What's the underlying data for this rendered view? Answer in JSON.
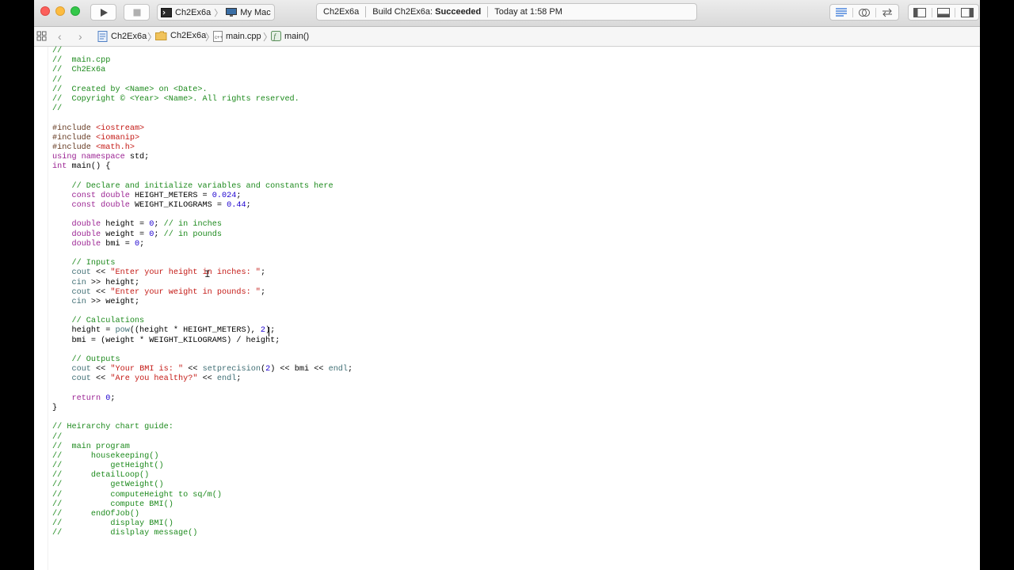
{
  "toolbar": {
    "scheme_target": "Ch2Ex6a",
    "scheme_device": "My Mac",
    "status_project": "Ch2Ex6a",
    "status_build_prefix": "Build Ch2Ex6a:",
    "status_build_result": "Succeeded",
    "status_time": "Today at 1:58 PM"
  },
  "jumpbar": {
    "items": [
      "Ch2Ex6a",
      "Ch2Ex6a",
      "main.cpp",
      "main()"
    ]
  },
  "editor": {
    "lines": [
      [
        {
          "t": "//",
          "c": "c"
        }
      ],
      [
        {
          "t": "//  main.cpp",
          "c": "c"
        }
      ],
      [
        {
          "t": "//  Ch2Ex6a",
          "c": "c"
        }
      ],
      [
        {
          "t": "//",
          "c": "c"
        }
      ],
      [
        {
          "t": "//  Created by <Name> on <Date>.",
          "c": "c"
        }
      ],
      [
        {
          "t": "//  Copyright © <Year> <Name>. All rights reserved.",
          "c": "c"
        }
      ],
      [
        {
          "t": "//",
          "c": "c"
        }
      ],
      [],
      [
        {
          "t": "#include ",
          "c": "p"
        },
        {
          "t": "<iostream>",
          "c": "s"
        }
      ],
      [
        {
          "t": "#include ",
          "c": "p"
        },
        {
          "t": "<iomanip>",
          "c": "s"
        }
      ],
      [
        {
          "t": "#include ",
          "c": "p"
        },
        {
          "t": "<math.h>",
          "c": "s"
        }
      ],
      [
        {
          "t": "using namespace ",
          "c": "k"
        },
        {
          "t": "std;",
          "c": ""
        }
      ],
      [
        {
          "t": "int ",
          "c": "k"
        },
        {
          "t": "main() {",
          "c": ""
        }
      ],
      [],
      [
        {
          "t": "    // Declare and initialize variables and constants here",
          "c": "c"
        }
      ],
      [
        {
          "t": "    ",
          "c": ""
        },
        {
          "t": "const double ",
          "c": "k"
        },
        {
          "t": "HEIGHT_METERS = ",
          "c": ""
        },
        {
          "t": "0.024",
          "c": "n"
        },
        {
          "t": ";",
          "c": ""
        }
      ],
      [
        {
          "t": "    ",
          "c": ""
        },
        {
          "t": "const double ",
          "c": "k"
        },
        {
          "t": "WEIGHT_KILOGRAMS = ",
          "c": ""
        },
        {
          "t": "0.44",
          "c": "n"
        },
        {
          "t": ";",
          "c": ""
        }
      ],
      [],
      [
        {
          "t": "    ",
          "c": ""
        },
        {
          "t": "double ",
          "c": "k"
        },
        {
          "t": "height = ",
          "c": ""
        },
        {
          "t": "0",
          "c": "n"
        },
        {
          "t": "; ",
          "c": ""
        },
        {
          "t": "// in inches",
          "c": "c"
        }
      ],
      [
        {
          "t": "    ",
          "c": ""
        },
        {
          "t": "double ",
          "c": "k"
        },
        {
          "t": "weight = ",
          "c": ""
        },
        {
          "t": "0",
          "c": "n"
        },
        {
          "t": "; ",
          "c": ""
        },
        {
          "t": "// in pounds",
          "c": "c"
        }
      ],
      [
        {
          "t": "    ",
          "c": ""
        },
        {
          "t": "double ",
          "c": "k"
        },
        {
          "t": "bmi = ",
          "c": ""
        },
        {
          "t": "0",
          "c": "n"
        },
        {
          "t": ";",
          "c": ""
        }
      ],
      [],
      [
        {
          "t": "    // Inputs",
          "c": "c"
        }
      ],
      [
        {
          "t": "    ",
          "c": ""
        },
        {
          "t": "cout",
          "c": "d"
        },
        {
          "t": " << ",
          "c": ""
        },
        {
          "t": "\"Enter your height in inches: \"",
          "c": "s"
        },
        {
          "t": ";",
          "c": ""
        }
      ],
      [
        {
          "t": "    ",
          "c": ""
        },
        {
          "t": "cin",
          "c": "d"
        },
        {
          "t": " >> height;",
          "c": ""
        }
      ],
      [
        {
          "t": "    ",
          "c": ""
        },
        {
          "t": "cout",
          "c": "d"
        },
        {
          "t": " << ",
          "c": ""
        },
        {
          "t": "\"Enter your weight in pounds: \"",
          "c": "s"
        },
        {
          "t": ";",
          "c": ""
        }
      ],
      [
        {
          "t": "    ",
          "c": ""
        },
        {
          "t": "cin",
          "c": "d"
        },
        {
          "t": " >> weight;",
          "c": ""
        }
      ],
      [],
      [
        {
          "t": "    // Calculations",
          "c": "c"
        }
      ],
      [
        {
          "t": "    height = ",
          "c": ""
        },
        {
          "t": "pow",
          "c": "d"
        },
        {
          "t": "((height * HEIGHT_METERS), ",
          "c": ""
        },
        {
          "t": "2",
          "c": "n"
        },
        {
          "t": ");",
          "c": ""
        }
      ],
      [
        {
          "t": "    bmi = (weight * WEIGHT_KILOGRAMS) / height;",
          "c": ""
        }
      ],
      [],
      [
        {
          "t": "    // Outputs",
          "c": "c"
        }
      ],
      [
        {
          "t": "    ",
          "c": ""
        },
        {
          "t": "cout",
          "c": "d"
        },
        {
          "t": " << ",
          "c": ""
        },
        {
          "t": "\"Your BMI is: \"",
          "c": "s"
        },
        {
          "t": " << ",
          "c": ""
        },
        {
          "t": "setprecision",
          "c": "d"
        },
        {
          "t": "(",
          "c": ""
        },
        {
          "t": "2",
          "c": "n"
        },
        {
          "t": ") << bmi << ",
          "c": ""
        },
        {
          "t": "endl",
          "c": "d"
        },
        {
          "t": ";",
          "c": ""
        }
      ],
      [
        {
          "t": "    ",
          "c": ""
        },
        {
          "t": "cout",
          "c": "d"
        },
        {
          "t": " << ",
          "c": ""
        },
        {
          "t": "\"Are you healthy?\"",
          "c": "s"
        },
        {
          "t": " << ",
          "c": ""
        },
        {
          "t": "endl",
          "c": "d"
        },
        {
          "t": ";",
          "c": ""
        }
      ],
      [],
      [
        {
          "t": "    ",
          "c": ""
        },
        {
          "t": "return ",
          "c": "k"
        },
        {
          "t": "0",
          "c": "n"
        },
        {
          "t": ";",
          "c": ""
        }
      ],
      [
        {
          "t": "}",
          "c": ""
        }
      ],
      [],
      [
        {
          "t": "// Heirarchy chart guide:",
          "c": "c"
        }
      ],
      [
        {
          "t": "//",
          "c": "c"
        }
      ],
      [
        {
          "t": "//  main program",
          "c": "c"
        }
      ],
      [
        {
          "t": "//      housekeeping()",
          "c": "c"
        }
      ],
      [
        {
          "t": "//          getHeight()",
          "c": "c"
        }
      ],
      [
        {
          "t": "//      detailLoop()",
          "c": "c"
        }
      ],
      [
        {
          "t": "//          getWeight()",
          "c": "c"
        }
      ],
      [
        {
          "t": "//          computeHeight to sq/m()",
          "c": "c"
        }
      ],
      [
        {
          "t": "//          compute BMI()",
          "c": "c"
        }
      ],
      [
        {
          "t": "//      endOfJob()",
          "c": "c"
        }
      ],
      [
        {
          "t": "//          display BMI()",
          "c": "c"
        }
      ],
      [
        {
          "t": "//          dislplay message()",
          "c": "c"
        }
      ]
    ]
  },
  "colors": {
    "close": "#fc605c",
    "minimize": "#fdbc40",
    "zoom": "#34c84a",
    "comment": "#1d8a1d",
    "keyword": "#9b2393",
    "string": "#c41a16",
    "number": "#1c00cf"
  },
  "icons": [
    "run-icon",
    "stop-icon",
    "terminal-icon",
    "mac-icon",
    "editor-standard-icon",
    "editor-assistant-icon",
    "editor-version-icon",
    "navigator-toggle-icon",
    "debug-toggle-icon",
    "utilities-toggle-icon",
    "grid-icon",
    "back-icon",
    "forward-icon",
    "project-icon",
    "folder-icon",
    "cpp-file-icon",
    "function-icon"
  ]
}
